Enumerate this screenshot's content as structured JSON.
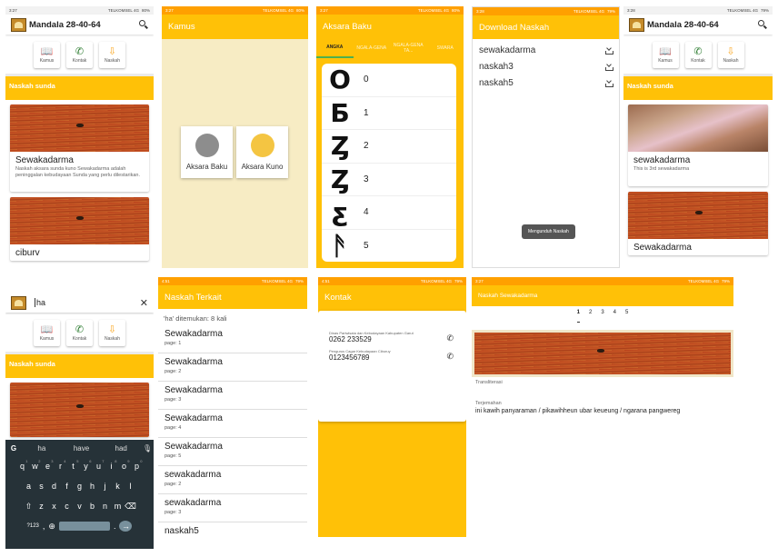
{
  "colors": {
    "primary": "#ffc107",
    "status": "#ffa000",
    "accent_green": "#4caf50",
    "manuscript": "#b8401c"
  },
  "status": {
    "time_a": "3:27",
    "time_b": "3:28",
    "time_c": "4:51",
    "time_d": "3:27",
    "carrier": "TELKOMSEL 4G",
    "carrier_b": "TELKOMSEL 4G 3G",
    "battery_a": "80%",
    "battery_b": "79%"
  },
  "home": {
    "title": "Mandala 28-40-64",
    "quick": [
      {
        "label": "Kamus",
        "icon": "book-icon"
      },
      {
        "label": "Kontak",
        "icon": "phone-icon"
      },
      {
        "label": "Naskah",
        "icon": "download-icon"
      }
    ],
    "section": "Naskah sunda",
    "cards": [
      {
        "title": "Sewakadarma",
        "desc": "Naskah aksara sunda kuno Sewakadarma adalah peninggalan kebudayaan Sunda yang perlu dilestarikan."
      },
      {
        "title": "ciburv"
      }
    ]
  },
  "kamus": {
    "title": "Kamus",
    "buttons": [
      "Aksara Baku",
      "Aksara Kuno"
    ]
  },
  "aksara": {
    "title": "Aksara Baku",
    "tabs": [
      "ANGKA",
      "NGALA-GENA",
      "NGALA-GENA TA...",
      "SWARA"
    ],
    "digits": [
      {
        "glyph": "O",
        "value": "0"
      },
      {
        "glyph": "Ƃ",
        "value": "1"
      },
      {
        "glyph": "Ȥ",
        "value": "2"
      },
      {
        "glyph": "Ȥ",
        "value": "3"
      },
      {
        "glyph": "ƹ",
        "value": "4"
      },
      {
        "glyph": "ᚫ",
        "value": "5"
      }
    ]
  },
  "download": {
    "title": "Download Naskah",
    "items": [
      "sewakadarma",
      "naskah3",
      "naskah5"
    ],
    "toast": "Mengunduh Naskah"
  },
  "home2": {
    "title": "Mandala 28-40-64",
    "section": "Naskah sunda",
    "cards": [
      {
        "title": "sewakadarma",
        "desc": "This is 3rd sewakadarma"
      },
      {
        "title": "Sewakadarma"
      }
    ]
  },
  "search": {
    "query": "ha",
    "suggestions": [
      "ha",
      "have",
      "had"
    ],
    "rows": [
      [
        "q",
        "w",
        "e",
        "r",
        "t",
        "y",
        "u",
        "i",
        "o",
        "p"
      ],
      [
        "a",
        "s",
        "d",
        "f",
        "g",
        "h",
        "j",
        "k",
        "l"
      ],
      [
        "z",
        "x",
        "c",
        "v",
        "b",
        "n",
        "m"
      ]
    ],
    "row_nums": [
      "1",
      "2",
      "3",
      "4",
      "5",
      "6",
      "7",
      "8",
      "9",
      "0"
    ],
    "sym_key": "?123"
  },
  "terkait": {
    "title": "Naskah Terkait",
    "summary": "'ha' ditemukan: 8 kali",
    "results": [
      {
        "title": "Sewakadarma",
        "page": "page: 1"
      },
      {
        "title": "Sewakadarma",
        "page": "page: 2"
      },
      {
        "title": "Sewakadarma",
        "page": "page: 3"
      },
      {
        "title": "Sewakadarma",
        "page": "page: 4"
      },
      {
        "title": "Sewakadarma",
        "page": "page: 5"
      },
      {
        "title": "sewakadarma",
        "page": "page: 2"
      },
      {
        "title": "sewakadarma",
        "page": "page: 3"
      },
      {
        "title": "naskah5",
        "page": ""
      }
    ]
  },
  "kontak": {
    "title": "Kontak",
    "contacts": [
      {
        "label": "Dinas Pariwisata dan Kebudayaan Kabupaten Garut",
        "phone": "0262 233529"
      },
      {
        "label": "Pengurus Cagar Kebudayaan Ciburuy",
        "phone": "0123456789"
      }
    ]
  },
  "naskah": {
    "title": "Naskah Sewakadarma",
    "pages": [
      "1",
      "2",
      "3",
      "4",
      "5"
    ],
    "transliterasi": "Transliterasi",
    "terjemahan": "Terjemahan",
    "text": "ini kawih panyaraman / pikawihheun ubar keueung / ngarana pangwereg"
  }
}
